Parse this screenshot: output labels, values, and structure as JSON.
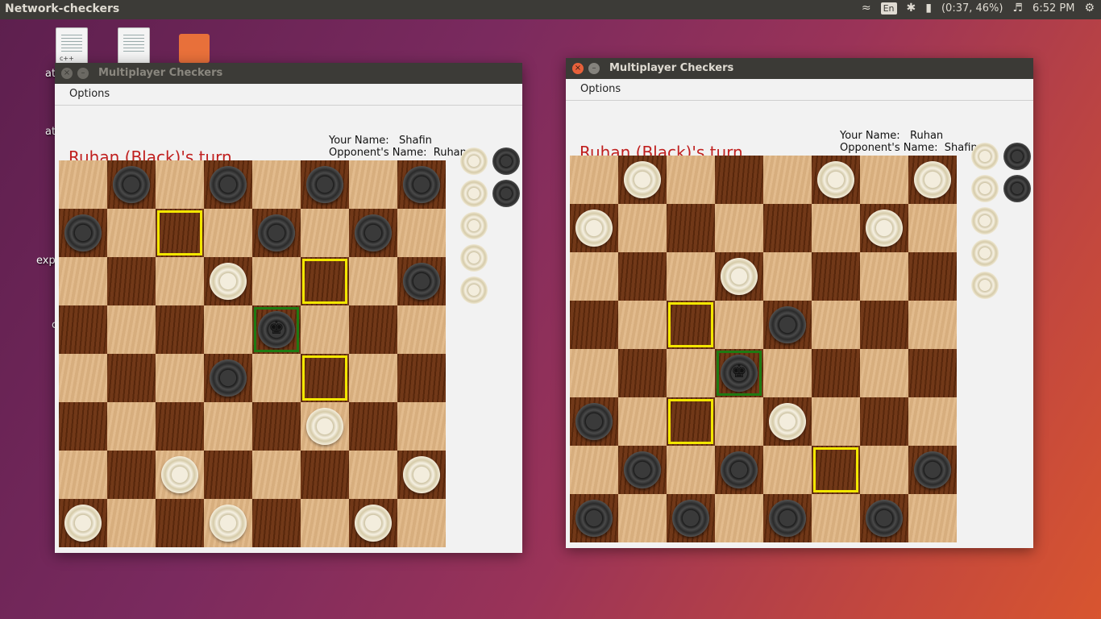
{
  "topbar": {
    "app_title": "Network-checkers",
    "lang": "En",
    "battery": "(0:37, 46%)",
    "time": "6:52 PM"
  },
  "desktop": {
    "icons": [
      "text-file",
      "text-file",
      "folder"
    ],
    "cpp_tag": "c++",
    "labels": [
      "at",
      "at",
      "exp",
      "c"
    ]
  },
  "windows": [
    {
      "title": "Multiplayer Checkers",
      "menu": "Options",
      "turn_text": "Ruhan (Black)'s turn",
      "your_name_label": "Your Name:",
      "your_name": "Shafin",
      "opponent_label": "Opponent's Name:",
      "opponent_name": "Ruhan",
      "board": [
        ". b . b . b . b",
        "b . . . b . b .",
        ". . . w . . . b",
        ". . . . B . . .",
        ". . . b . . . .",
        ". . . . . w . .",
        ". . w . . . . w",
        "w . . w . . w ."
      ],
      "highlights": [
        {
          "row": 1,
          "col": 2,
          "color": "yellow"
        },
        {
          "row": 2,
          "col": 5,
          "color": "yellow"
        },
        {
          "row": 4,
          "col": 5,
          "color": "yellow"
        },
        {
          "row": 3,
          "col": 4,
          "color": "green"
        }
      ],
      "captured_white": 5,
      "captured_black": 2
    },
    {
      "title": "Multiplayer Checkers",
      "menu": "Options",
      "turn_text": "Ruhan (Black)'s turn",
      "your_name_label": "Your Name:",
      "your_name": "Ruhan",
      "opponent_label": "Opponent's Name:",
      "opponent_name": "Shafin",
      "board": [
        ". w . . . w . w",
        "w . . . . . w .",
        ". . . w . . . .",
        ". . . . b . . .",
        ". . . B . . . .",
        "b . . . w . . .",
        ". b . b . . . b",
        "b . b . b . b ."
      ],
      "highlights": [
        {
          "row": 3,
          "col": 2,
          "color": "yellow"
        },
        {
          "row": 5,
          "col": 2,
          "color": "yellow"
        },
        {
          "row": 6,
          "col": 5,
          "color": "yellow"
        },
        {
          "row": 4,
          "col": 3,
          "color": "green"
        }
      ],
      "captured_white": 5,
      "captured_black": 2
    }
  ]
}
